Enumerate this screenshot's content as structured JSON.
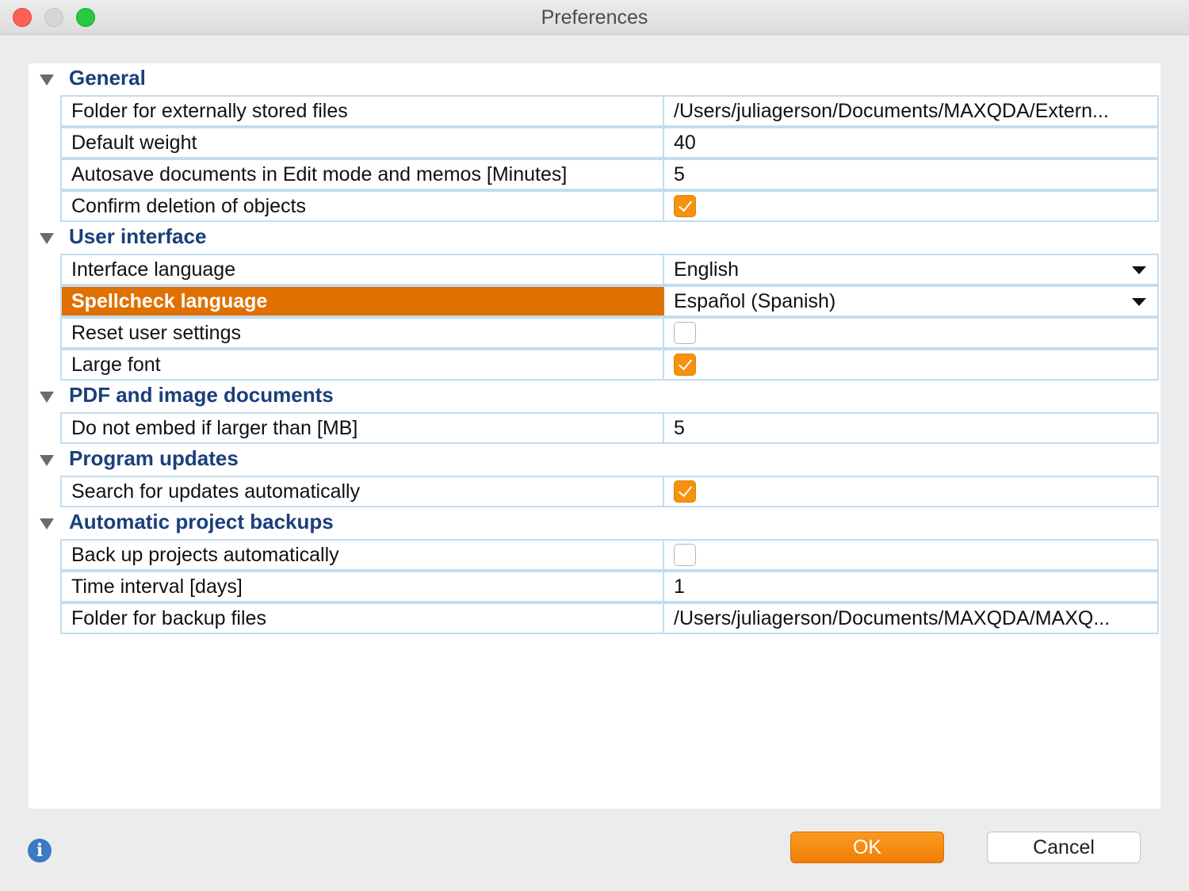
{
  "window": {
    "title": "Preferences"
  },
  "sections": [
    {
      "title": "General",
      "rows": [
        {
          "label": "Folder for externally stored files",
          "type": "text",
          "value": "/Users/juliagerson/Documents/MAXQDA/Extern..."
        },
        {
          "label": "Default weight",
          "type": "text",
          "value": "40"
        },
        {
          "label": "Autosave documents in Edit mode and memos [Minutes]",
          "type": "text",
          "value": "5"
        },
        {
          "label": "Confirm deletion of objects",
          "type": "checkbox",
          "checked": true
        }
      ]
    },
    {
      "title": "User interface",
      "rows": [
        {
          "label": "Interface language",
          "type": "dropdown",
          "value": "English"
        },
        {
          "label": "Spellcheck language",
          "type": "dropdown",
          "value": "Español (Spanish)",
          "selected": true
        },
        {
          "label": "Reset user settings",
          "type": "checkbox",
          "checked": false
        },
        {
          "label": "Large font",
          "type": "checkbox",
          "checked": true
        }
      ]
    },
    {
      "title": "PDF and image documents",
      "rows": [
        {
          "label": "Do not embed if larger than [MB]",
          "type": "text",
          "value": "5"
        }
      ]
    },
    {
      "title": "Program updates",
      "rows": [
        {
          "label": "Search for updates automatically",
          "type": "checkbox",
          "checked": true
        }
      ]
    },
    {
      "title": "Automatic project backups",
      "rows": [
        {
          "label": "Back up projects automatically",
          "type": "checkbox",
          "checked": false
        },
        {
          "label": "Time interval [days]",
          "type": "text",
          "value": "1"
        },
        {
          "label": "Folder for backup files",
          "type": "text",
          "value": "/Users/juliagerson/Documents/MAXQDA/MAXQ..."
        }
      ]
    }
  ],
  "buttons": {
    "ok": "OK",
    "cancel": "Cancel"
  },
  "colors": {
    "accent": "#e07000",
    "section_title": "#1a3f7c",
    "grid": "#c2ddf0"
  },
  "icons": {
    "info": "info-icon",
    "collapse": "triangle-down-icon"
  }
}
